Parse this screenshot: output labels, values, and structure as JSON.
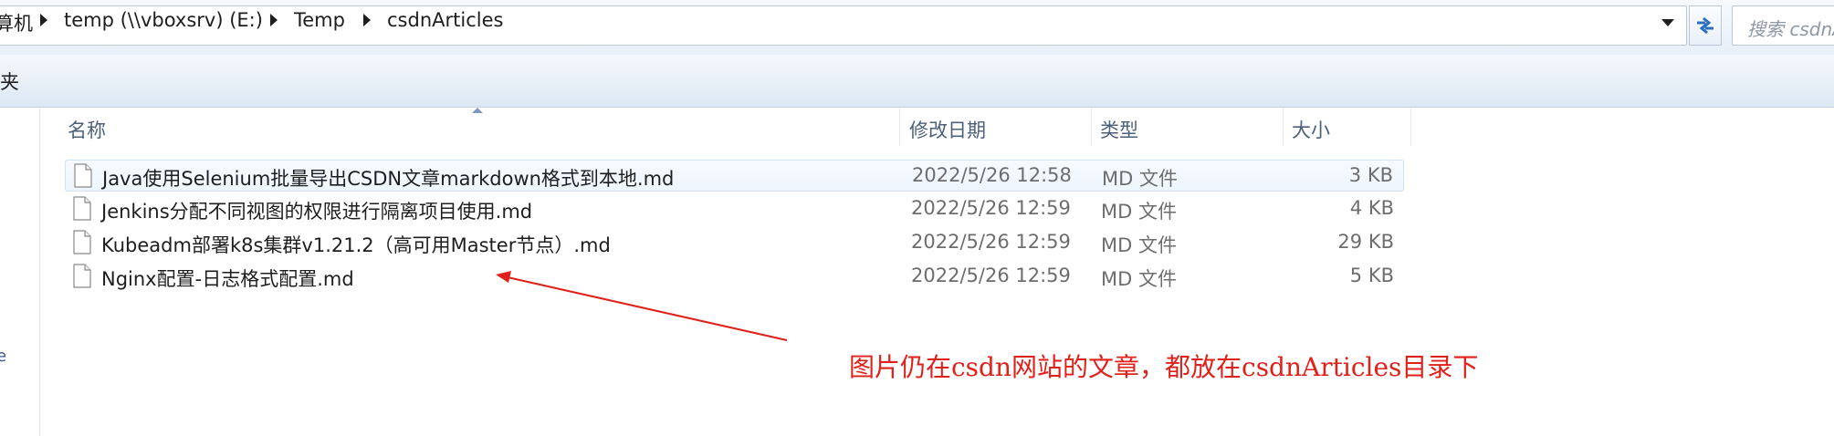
{
  "address_bar": {
    "crumbs": [
      "算机",
      "temp (\\\\vboxsrv) (E:)",
      "Temp",
      "csdnArticles"
    ],
    "search_placeholder": "搜索 csdnArticles"
  },
  "toolbar": {
    "label": "夹"
  },
  "nav_fragment": "e",
  "columns": [
    "名称",
    "修改日期",
    "类型",
    "大小"
  ],
  "files": [
    {
      "name": "Java使用Selenium批量导出CSDN文章markdown格式到本地.md",
      "date": "2022/5/26 12:58",
      "type": "MD 文件",
      "size": "3 KB"
    },
    {
      "name": "Jenkins分配不同视图的权限进行隔离项目使用.md",
      "date": "2022/5/26 12:59",
      "type": "MD 文件",
      "size": "4 KB"
    },
    {
      "name": "Kubeadm部署k8s集群v1.21.2（高可用Master节点）.md",
      "date": "2022/5/26 12:59",
      "type": "MD 文件",
      "size": "29 KB"
    },
    {
      "name": "Nginx配置-日志格式配置.md",
      "date": "2022/5/26 12:59",
      "type": "MD 文件",
      "size": "5 KB"
    }
  ],
  "annotation": "图片仍在csdn网站的文章，都放在csdnArticles目录下",
  "colors": {
    "annotation": "#e0201a",
    "hover_row": "#edf5fe"
  },
  "icons": [
    "chevron-right-icon",
    "dropdown-arrow-icon",
    "refresh-icon",
    "file-icon",
    "sort-arrow-icon"
  ]
}
